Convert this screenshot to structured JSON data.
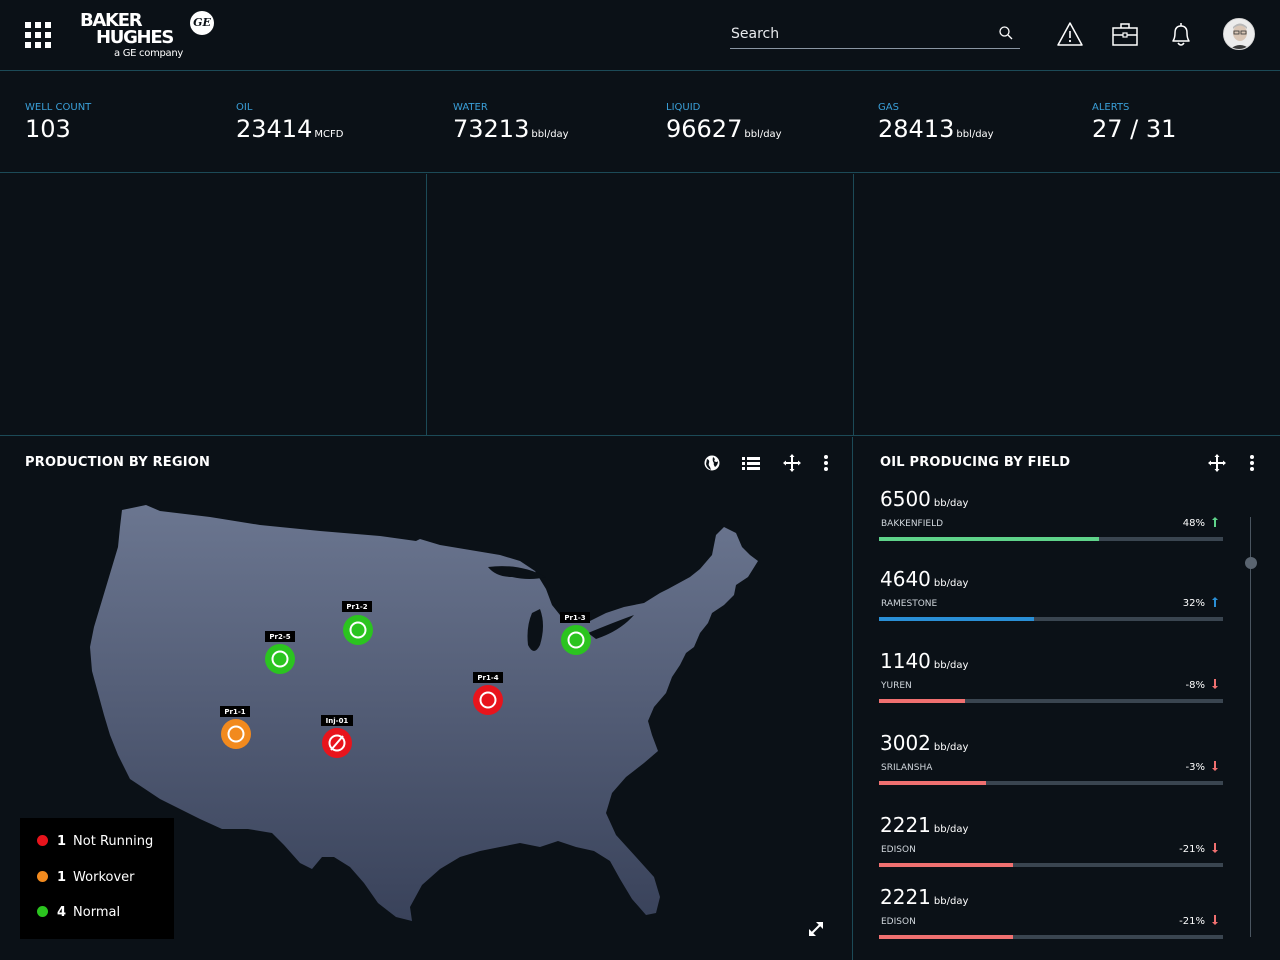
{
  "header": {
    "brand_line1": "BAKER",
    "brand_line2": "HUGHES",
    "brand_line3": "a GE company",
    "ge_mark": "GE",
    "search_placeholder": "Search",
    "icons": [
      "apps-grid-icon",
      "search-icon",
      "alert-triangle-icon",
      "briefcase-icon",
      "bell-icon"
    ]
  },
  "kpis": [
    {
      "label": "WELL COUNT",
      "value": "103",
      "unit": ""
    },
    {
      "label": "OIL",
      "value": "23414",
      "unit": "MCFD"
    },
    {
      "label": "WATER",
      "value": "73213",
      "unit": "bbl/day"
    },
    {
      "label": "LIQUID",
      "value": "96627",
      "unit": "bbl/day"
    },
    {
      "label": "GAS",
      "value": "28413",
      "unit": "bbl/day"
    },
    {
      "label": "ALERTS",
      "value": "27 / 31",
      "unit": ""
    }
  ],
  "production": {
    "title": "PRODUCTION BY REGION",
    "tool_icons": [
      "globe-icon",
      "list-icon",
      "move-icon",
      "more-vertical-icon"
    ],
    "wells": [
      {
        "id": "Pr1-2",
        "status": "normal"
      },
      {
        "id": "Pr2-5",
        "status": "normal"
      },
      {
        "id": "Pr1-3",
        "status": "normal"
      },
      {
        "id": "Pr1-4",
        "status": "not-running"
      },
      {
        "id": "Pr1-1",
        "status": "workover"
      },
      {
        "id": "Inj-01",
        "status": "not-running-injector"
      }
    ],
    "legend": [
      {
        "count": "1",
        "label": "Not Running",
        "color": "#e8141c"
      },
      {
        "count": "1",
        "label": "Workover",
        "color": "#f28a1e"
      },
      {
        "count": "4",
        "label": "Normal",
        "color": "#2bc41f"
      }
    ]
  },
  "oil": {
    "title": "OIL PRODUCING BY FIELD",
    "tool_icons": [
      "move-icon",
      "more-vertical-icon"
    ],
    "fields": [
      {
        "value": "6500",
        "unit": "bb/day",
        "name": "BAKKENFIELD",
        "pct": "48%",
        "direction": "up",
        "fill": 0.64,
        "color": "#5fd38a",
        "arrow_color": "#5fd38a"
      },
      {
        "value": "4640",
        "unit": "bb/day",
        "name": "RAMESTONE",
        "pct": "32%",
        "direction": "up",
        "fill": 0.45,
        "color": "#2a8fd6",
        "arrow_color": "#2a8fd6"
      },
      {
        "value": "1140",
        "unit": "bb/day",
        "name": "YUREN",
        "pct": "-8%",
        "direction": "down",
        "fill": 0.25,
        "color": "#f07070",
        "arrow_color": "#f07070"
      },
      {
        "value": "3002",
        "unit": "bb/day",
        "name": "SRILANSHA",
        "pct": "-3%",
        "direction": "down",
        "fill": 0.31,
        "color": "#f07070",
        "arrow_color": "#f07070"
      },
      {
        "value": "2221",
        "unit": "bb/day",
        "name": "EDISON",
        "pct": "-21%",
        "direction": "down",
        "fill": 0.39,
        "color": "#f07070",
        "arrow_color": "#f07070"
      },
      {
        "value": "2221",
        "unit": "bb/day",
        "name": "EDISON",
        "pct": "-21%",
        "direction": "down",
        "fill": 0.39,
        "color": "#f07070",
        "arrow_color": "#f07070"
      }
    ]
  },
  "colors": {
    "accent": "#3a9fd8",
    "border": "#1c4a57",
    "background": "#0b1117"
  }
}
